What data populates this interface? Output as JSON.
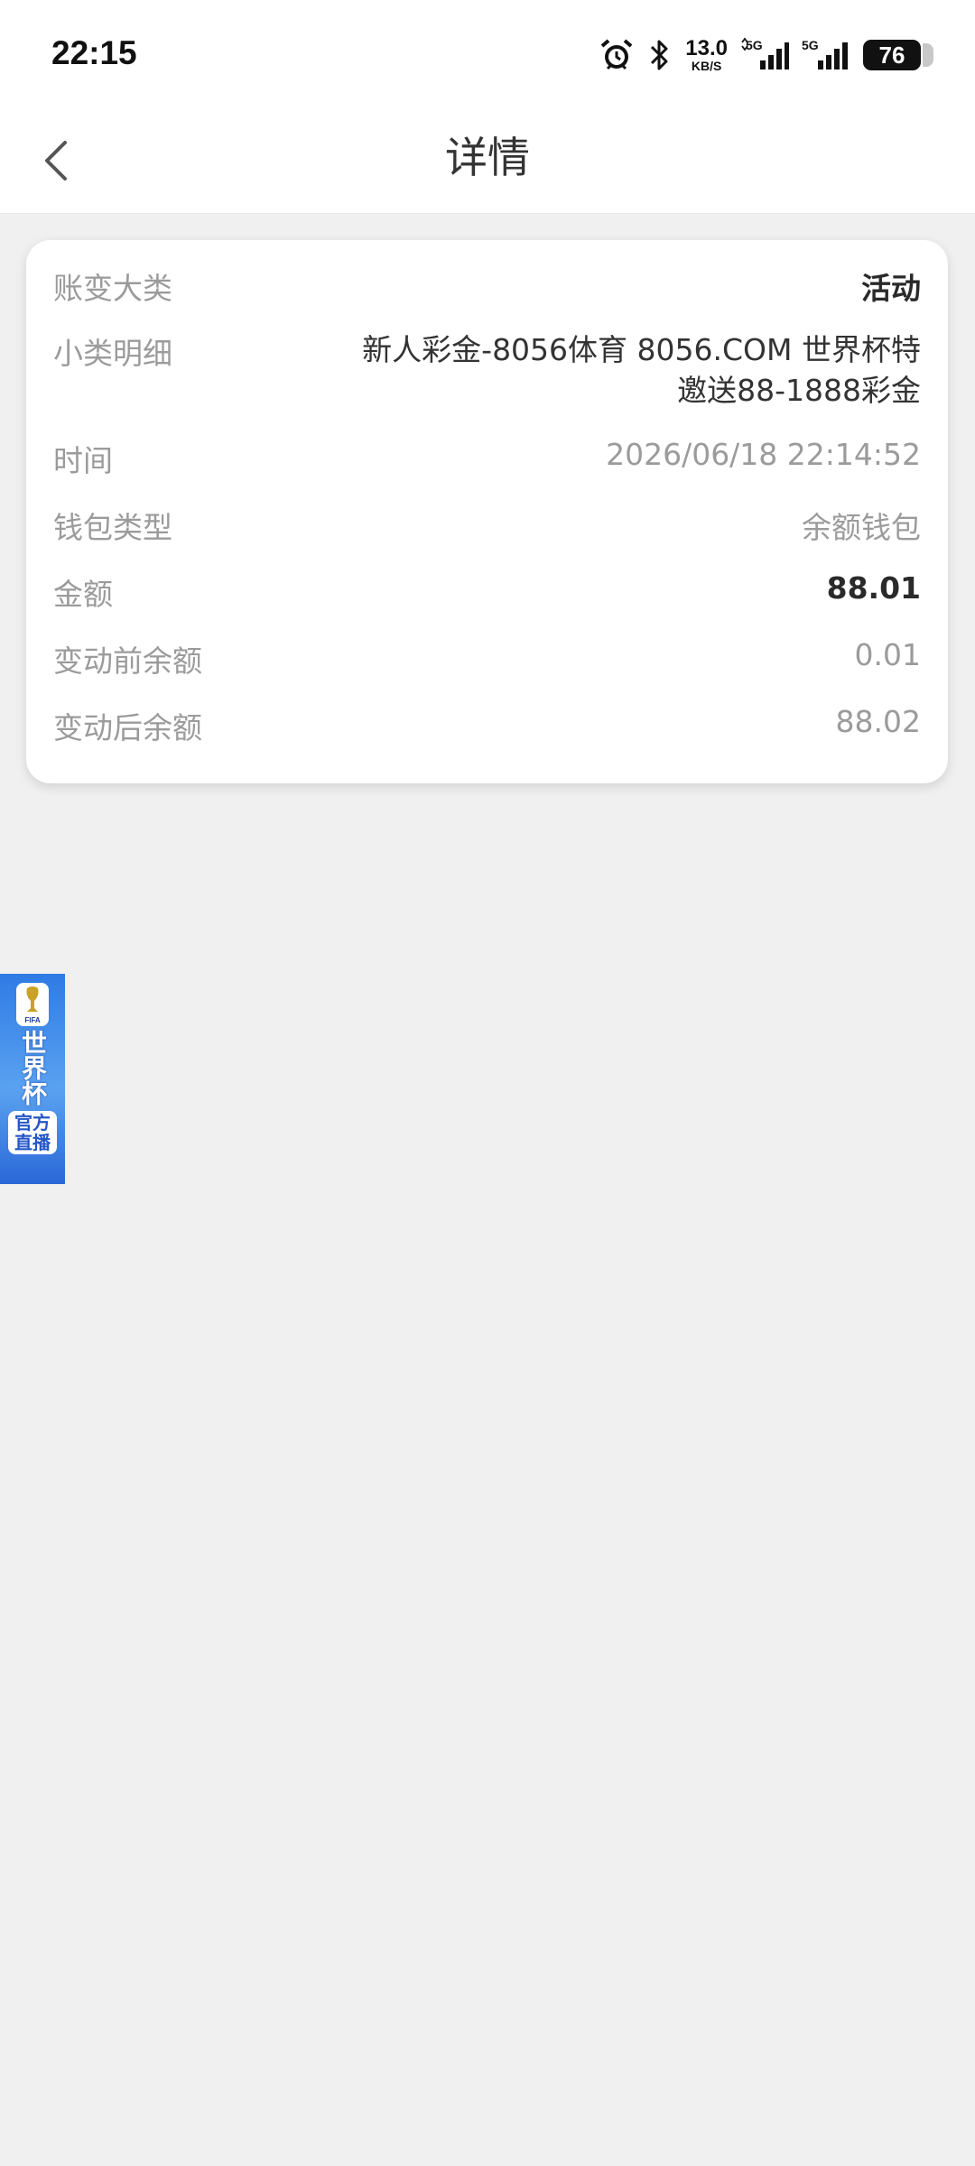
{
  "status_bar": {
    "time": "22:15",
    "net_speed_value": "13.0",
    "net_speed_unit": "KB/S",
    "battery": "76",
    "icons": [
      "alarm-icon",
      "bluetooth-icon",
      "signal-5g-icon",
      "signal-5g-icon",
      "battery-icon"
    ]
  },
  "nav": {
    "title": "详情"
  },
  "details": [
    {
      "label": "账变大类",
      "value": "活动",
      "style": "strong"
    },
    {
      "label": "小类明细",
      "value_lines": [
        "新人彩金-8056体育 8056.COM 世界杯特",
        "邀送88-1888彩金"
      ],
      "style": "dark"
    },
    {
      "label": "时间",
      "value": "2026/06/18 22:14:52",
      "style": "muted"
    },
    {
      "label": "钱包类型",
      "value": "余额钱包",
      "style": "muted"
    },
    {
      "label": "金额",
      "value": "88.01",
      "style": "strong"
    },
    {
      "label": "变动前余额",
      "value": "0.01",
      "style": "muted"
    },
    {
      "label": "变动后余额",
      "value": "88.02",
      "style": "muted"
    }
  ],
  "banner": {
    "title": "世界杯",
    "tag_line1": "官方",
    "tag_line2": "直播",
    "fifa": "FIFA"
  },
  "colors": {
    "background": "#f0f0f0",
    "card": "#ffffff",
    "label": "#9b9b9b",
    "strong_value": "#2a2a2a",
    "banner_blue": "#2f7be5"
  }
}
